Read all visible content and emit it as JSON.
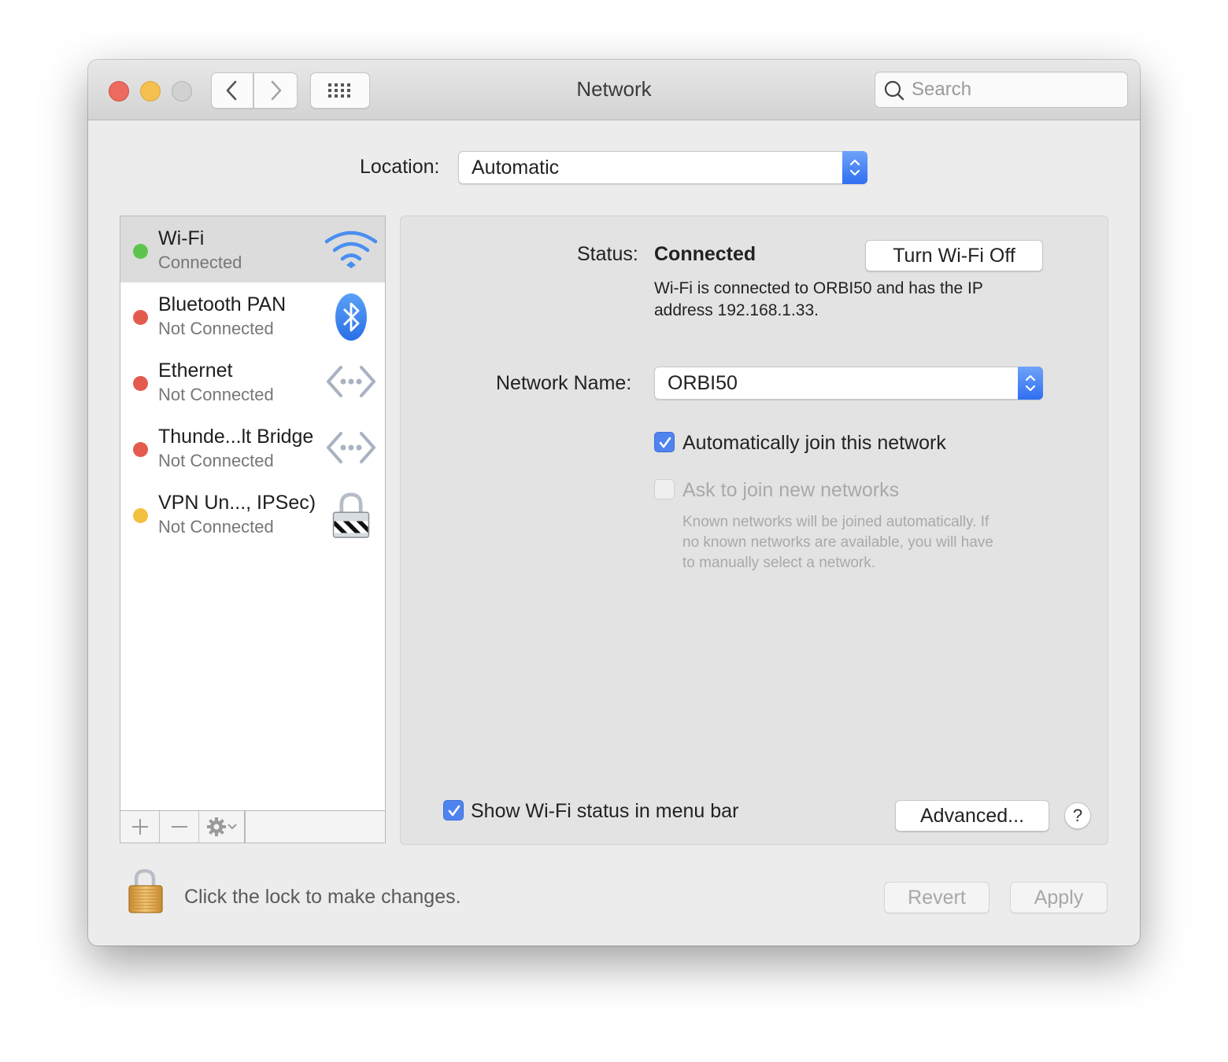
{
  "window": {
    "title": "Network",
    "search_placeholder": "Search"
  },
  "location": {
    "label": "Location:",
    "value": "Automatic"
  },
  "services": [
    {
      "name": "Wi-Fi",
      "status": "Connected",
      "status_color": "#5fc44e",
      "icon": "wifi-icon",
      "selected": true
    },
    {
      "name": "Bluetooth PAN",
      "status": "Not Connected",
      "status_color": "#e35b4f",
      "icon": "bluetooth-icon",
      "selected": false
    },
    {
      "name": "Ethernet",
      "status": "Not Connected",
      "status_color": "#e35b4f",
      "icon": "ethernet-icon",
      "selected": false
    },
    {
      "name": "Thunde...lt Bridge",
      "status": "Not Connected",
      "status_color": "#e35b4f",
      "icon": "ethernet-icon",
      "selected": false
    },
    {
      "name": "VPN Un..., IPSec)",
      "status": "Not Connected",
      "status_color": "#f2c141",
      "icon": "vpn-lock-icon",
      "selected": false
    }
  ],
  "sidebar_toolbar": {
    "add": "+",
    "remove": "—"
  },
  "detail": {
    "status_label": "Status:",
    "status_value": "Connected",
    "turn_off_button": "Turn Wi-Fi Off",
    "status_desc_line1": "Wi-Fi is connected to ORBI50 and has the IP",
    "status_desc_line2": "address 192.168.1.33.",
    "network_name_label": "Network Name:",
    "network_name_value": "ORBI50",
    "auto_join_label": "Automatically join this network",
    "auto_join_checked": true,
    "ask_join_label": "Ask to join new networks",
    "ask_join_checked": false,
    "ask_join_help_1": "Known networks will be joined automatically. If",
    "ask_join_help_2": "no known networks are available, you will have",
    "ask_join_help_3": "to manually select a network.",
    "show_status_label": "Show Wi-Fi status in menu bar",
    "show_status_checked": true,
    "advanced_button": "Advanced...",
    "help_button": "?"
  },
  "footer": {
    "lock_text": "Click the lock to make changes.",
    "revert_button": "Revert",
    "apply_button": "Apply"
  },
  "colors": {
    "accent": "#4f83ef",
    "connected": "#5fc44e",
    "not_connected": "#e35b4f",
    "inactive": "#f2c141"
  }
}
